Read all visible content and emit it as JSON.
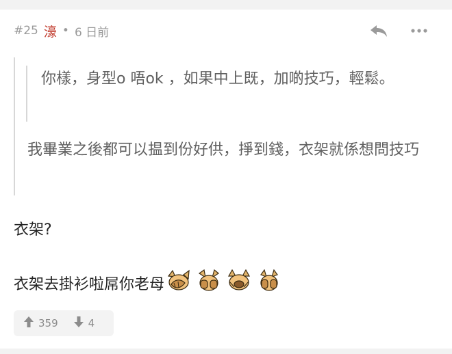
{
  "post": {
    "floor": "#25",
    "username": "濠",
    "separator": "•",
    "time": "6 日前"
  },
  "quote": {
    "nested": "你樣，身型o 唔ok ，如果中上既，加啲技巧，輕鬆。",
    "outer": "我畢業之後都可以揾到份好供，掙到錢，衣架就係想問技巧"
  },
  "content": {
    "line1": "衣架?",
    "line2": "衣架去掛衫啦屌你老母"
  },
  "emojis": [
    "dog-facepalm-icon",
    "dog-cover-face-icon",
    "dog-facepalm-icon",
    "dog-cover-face-icon"
  ],
  "votes": {
    "up": "359",
    "down": "4"
  },
  "colors": {
    "username": "#c0392b",
    "meta": "#9a9a9a",
    "quote_text": "#606060",
    "quote_border": "#d7d7d7"
  }
}
